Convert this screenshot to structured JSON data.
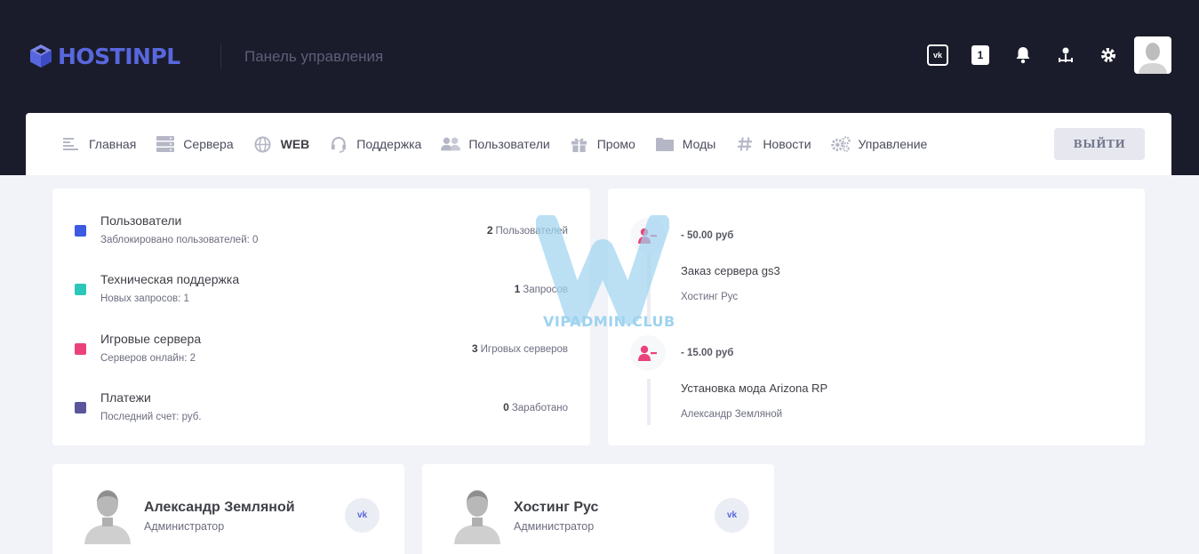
{
  "header": {
    "logo_text": "HOSTINPL",
    "panel_title": "Панель управления",
    "icons": [
      "vk-icon",
      "notification-count",
      "bell-icon",
      "sitemap-icon",
      "gear-icon",
      "avatar"
    ],
    "notification_count": "1",
    "vk_label": "vk"
  },
  "nav": {
    "items": [
      {
        "label": "Главная",
        "icon": "menu-lines-icon"
      },
      {
        "label": "Сервера",
        "icon": "server-icon"
      },
      {
        "label": "WEB",
        "icon": "globe-icon"
      },
      {
        "label": "Поддержка",
        "icon": "headset-icon"
      },
      {
        "label": "Пользователи",
        "icon": "users-icon"
      },
      {
        "label": "Промо",
        "icon": "gift-icon"
      },
      {
        "label": "Моды",
        "icon": "folder-icon"
      },
      {
        "label": "Новости",
        "icon": "hashtag-icon"
      },
      {
        "label": "Управление",
        "icon": "gears-icon"
      }
    ],
    "logout_label": "ВЫЙТИ"
  },
  "stats": [
    {
      "title": "Пользователи",
      "sub": "Заблокировано пользователей: 0",
      "count": "2",
      "unit": "Пользователей",
      "color": "#3d5ae3"
    },
    {
      "title": "Техническая поддержка",
      "sub": "Новых запросов: 1",
      "count": "1",
      "unit": "Запросов",
      "color": "#2cc7b9"
    },
    {
      "title": "Игровые сервера",
      "sub": "Серверов онлайн: 2",
      "count": "3",
      "unit": "Игровых серверов",
      "color": "#e9437a"
    },
    {
      "title": "Платежи",
      "sub": "Последний счет: руб.",
      "count": "0",
      "unit": "Заработано",
      "color": "#5b559b"
    }
  ],
  "timeline": [
    {
      "amount": "- 50.00 руб",
      "title": "Заказ сервера gs3",
      "sub": "Хостинг Рус",
      "icon": "user-minus-icon"
    },
    {
      "amount": "- 15.00 руб",
      "title": "Установка мода Arizona RP",
      "sub": "Александр Земляной",
      "icon": "user-minus-icon"
    }
  ],
  "admins": [
    {
      "name": "Александр Земляной",
      "role": "Администратор",
      "social": "vk"
    },
    {
      "name": "Хостинг Рус",
      "role": "Администратор",
      "social": "vk"
    }
  ],
  "watermark": {
    "text": "VIPADMIN.CLUB"
  },
  "colors": {
    "header_bg": "#1b1c2b",
    "brand": "#5867dd",
    "page_bg": "#f2f3f8",
    "accent_pink": "#e9437a"
  }
}
